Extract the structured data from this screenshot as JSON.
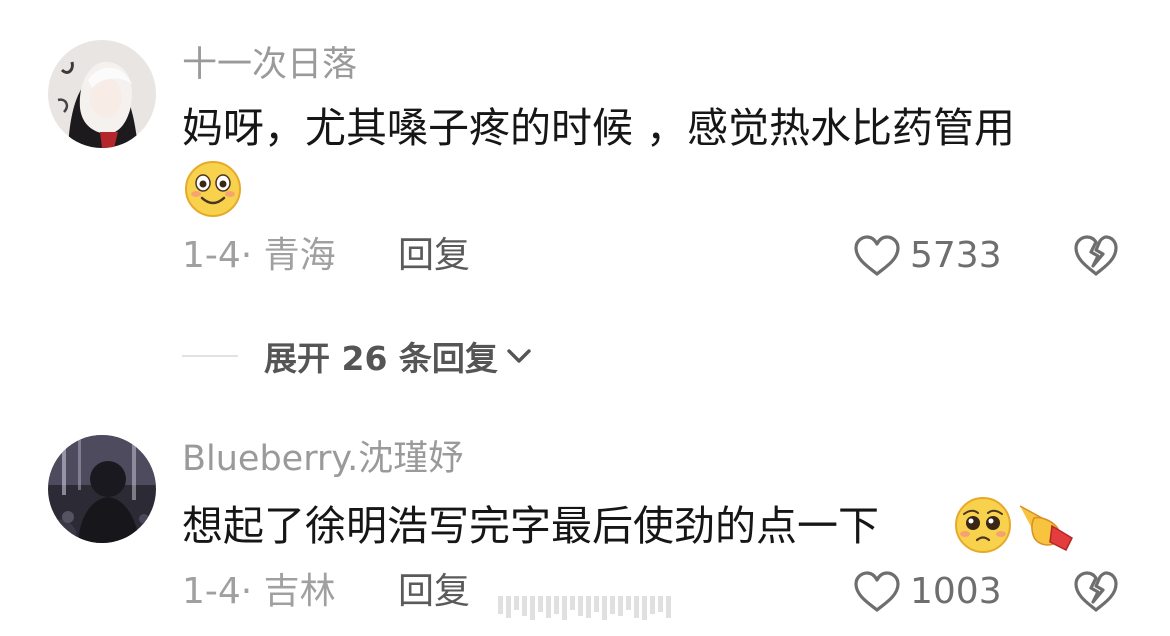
{
  "comments": [
    {
      "username": "十一次日落",
      "text": "妈呀，尤其嗓子疼的时候 ，感觉热水比药管用",
      "emojis": [
        "grinning-face-emoji"
      ],
      "date": "1-4",
      "location": "青海",
      "date_location": "1-4· 青海",
      "reply_label": "回复",
      "likes": "5733"
    },
    {
      "username": "Blueberry.沈瑾妤",
      "text": "想起了徐明浩写完字最后使劲的点一下",
      "emojis": [
        "pleading-face-emoji",
        "pointing-hand-emoji"
      ],
      "date": "1-4",
      "location": "吉林",
      "date_location": "1-4· 吉林",
      "reply_label": "回复",
      "likes": "1003"
    }
  ],
  "expand_replies": {
    "label": "展开 26 条回复",
    "icon": "chevron-down-icon"
  },
  "icons": {
    "like": "heart-outline-icon",
    "dislike": "broken-heart-outline-icon"
  },
  "colors": {
    "username": "#9a9a9a",
    "body_text": "#161616",
    "meta_text": "#a0a0a0",
    "reply_text": "#5a5a5a",
    "icon_stroke": "#6e6e6e"
  }
}
